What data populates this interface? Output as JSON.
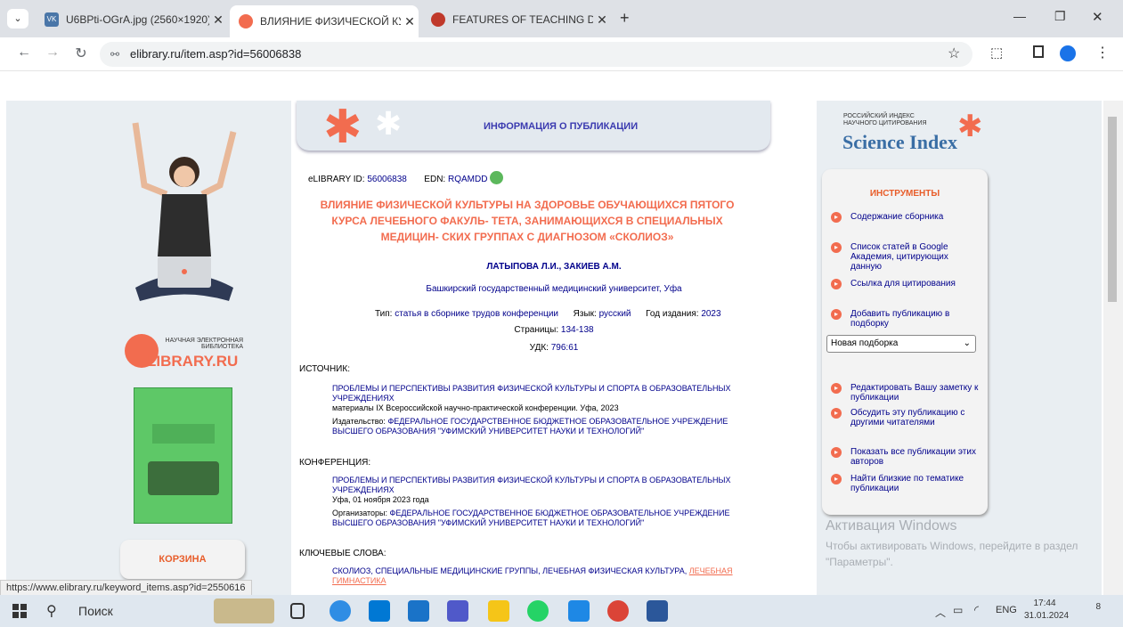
{
  "browser": {
    "tabs": [
      {
        "title": "U6BPti-OGrA.jpg (2560×1920)",
        "favicon_color": "#4a76a8",
        "favicon_text": "VK"
      },
      {
        "title": "ВЛИЯНИЕ ФИЗИЧЕСКОЙ КУЛЬ",
        "favicon_color": "#f26c4f",
        "favicon_text": ""
      },
      {
        "title": "FEATURES OF TEACHING DISCI",
        "favicon_color": "#c0392b",
        "favicon_text": ""
      }
    ],
    "url": "elibrary.ru/item.asp?id=56006838",
    "status_url": "https://www.elibrary.ru/keyword_items.asp?id=2550616"
  },
  "page": {
    "header_title": "ИНФОРМАЦИЯ О ПУБЛИКАЦИИ",
    "elibrary_id_label": "eLIBRARY ID:",
    "elibrary_id": "56006838",
    "edn_label": "EDN:",
    "edn": "RQAMDD",
    "title": "ВЛИЯНИЕ ФИЗИЧЕСКОЙ КУЛЬТУРЫ НА ЗДОРОВЬЕ ОБУЧАЮЩИХСЯ ПЯТОГО КУРСА ЛЕЧЕБНОГО ФАКУЛЬ- ТЕТА, ЗАНИМАЮЩИХСЯ В СПЕЦИАЛЬНЫХ МЕДИЦИН- СКИХ ГРУППАХ С ДИАГНОЗОМ «СКОЛИОЗ»",
    "authors": "ЛАТЫПОВА Л.И., ЗАКИЕВ А.М.",
    "affiliation": "Башкирский государственный медицинский университет, Уфа",
    "type_label": "Тип:",
    "type": "статья в сборнике трудов конференции",
    "lang_label": "Язык:",
    "lang": "русский",
    "year_label": "Год издания:",
    "year": "2023",
    "pages_label": "Страницы:",
    "pages": "134-138",
    "udk_label": "УДК:",
    "udk": "796:61",
    "source_label": "ИСТОЧНИК:",
    "source_title": "ПРОБЛЕМЫ И ПЕРСПЕКТИВЫ РАЗВИТИЯ ФИЗИЧЕСКОЙ КУЛЬТУРЫ И СПОРТА В ОБРАЗОВАТЕЛЬНЫХ УЧРЕЖДЕНИЯХ",
    "source_sub": "материалы IX Всероссийской научно-практической конференции. Уфа, 2023",
    "publisher_label": "Издательство:",
    "publisher": "ФЕДЕРАЛЬНОЕ ГОСУДАРСТВЕННОЕ БЮДЖЕТНОЕ ОБРАЗОВАТЕЛЬНОЕ УЧРЕЖДЕНИЕ ВЫСШЕГО ОБРАЗОВАНИЯ \"УФИМСКИЙ УНИВЕРСИТЕТ НАУКИ И ТЕХНОЛОГИЙ\"",
    "conference_label": "КОНФЕРЕНЦИЯ:",
    "conference_title": "ПРОБЛЕМЫ И ПЕРСПЕКТИВЫ РАЗВИТИЯ ФИЗИЧЕСКОЙ КУЛЬТУРЫ И СПОРТА В ОБРАЗОВАТЕЛЬНЫХ УЧРЕЖДЕНИЯХ",
    "conference_date": "Уфа, 01 ноября 2023 года",
    "organizers_label": "Организаторы:",
    "organizers": "ФЕДЕРАЛЬНОЕ ГОСУДАРСТВЕННОЕ БЮДЖЕТНОЕ ОБРАЗОВАТЕЛЬНОЕ УЧРЕЖДЕНИЕ ВЫСШЕГО ОБРАЗОВАНИЯ \"УФИМСКИЙ УНИВЕРСИТЕТ НАУКИ И ТЕХНОЛОГИЙ\"",
    "keywords_label": "КЛЮЧЕВЫЕ СЛОВА:",
    "keywords": "СКОЛИОЗ, СПЕЦИАЛЬНЫЕ МЕДИЦИНСКИЕ ГРУППЫ, ЛЕЧЕБНАЯ ФИЗИЧЕСКАЯ КУЛЬТУРА,",
    "keyword_hover": "ЛЕЧЕБНАЯ ГИМНАСТИКА"
  },
  "left": {
    "logo_small": "НАУЧНАЯ ЭЛЕКТРОННАЯ БИБЛИОТЕКА",
    "logo_big": "LIBRARY.RU",
    "cart": "КОРЗИНА"
  },
  "right": {
    "si_small1": "РОССИЙСКИЙ ИНДЕКС",
    "si_small2": "НАУЧНОГО ЦИТИРОВАНИЯ",
    "si_big": "Science Index",
    "tools_title": "ИНСТРУМЕНТЫ",
    "tools": [
      "Содержание сборника",
      "Список статей в Google Академия, цитирующих данную",
      "Ссылка для цитирования",
      "Добавить публикацию в подборку",
      "Редактировать Вашу заметку к публикации",
      "Обсудить эту публикацию с другими читателями",
      "Показать все публикации этих авторов",
      "Найти близкие по тематике публикации"
    ],
    "select_value": "Новая подборка",
    "activation_title": "Активация Windows",
    "activation_text": "Чтобы активировать Windows, перейдите в раздел \"Параметры\"."
  },
  "taskbar": {
    "search": "Поиск",
    "lang": "ENG",
    "time": "17:44",
    "date": "31.01.2024",
    "notif": "8"
  }
}
